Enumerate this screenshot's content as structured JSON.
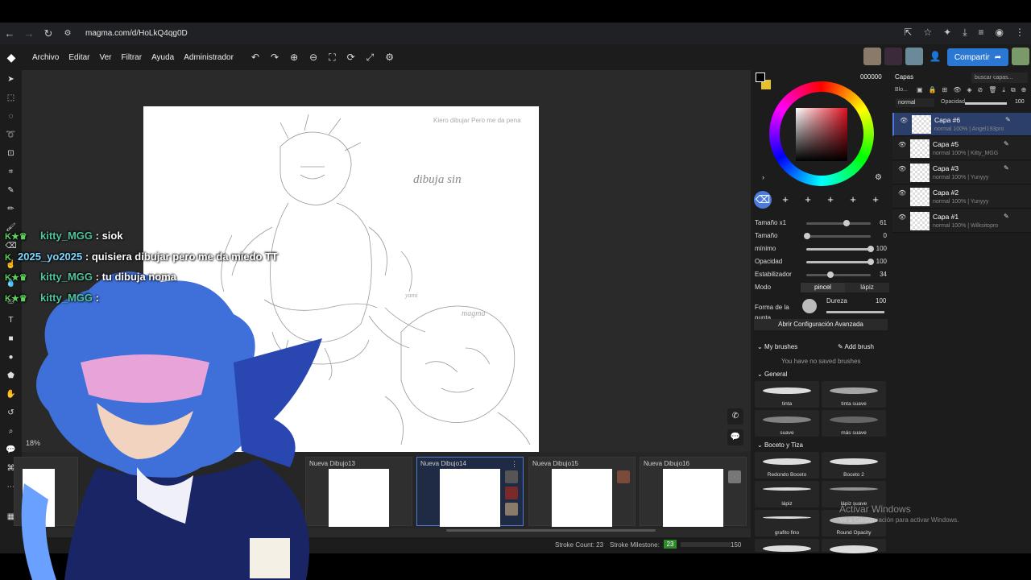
{
  "browser": {
    "url": "magma.com/d/HoLkQ4qg0D"
  },
  "menu": {
    "items": [
      "Archivo",
      "Editar",
      "Ver",
      "Filtrar",
      "Ayuda",
      "Administrador"
    ],
    "share_label": "Compartir"
  },
  "color_panel": {
    "hex": "000000",
    "primary_color": "#000000",
    "secondary_color": "#e6c12c"
  },
  "brush_slots": [
    "1",
    "2",
    "3",
    "4",
    "5",
    "6"
  ],
  "brush_props": {
    "size_x1_label": "Tamaño x1",
    "size_x1_value": "61",
    "size_label": "Tamaño",
    "size_value": "0",
    "min_label": "mínimo",
    "min_value": "100",
    "opacity_label": "Opacidad",
    "opacity_value": "100",
    "stabilizer_label": "Estabilizador",
    "stabilizer_value": "34",
    "mode_label": "Modo",
    "mode_pencil": "pincel",
    "mode_lapiz": "lápiz",
    "hardness_label": "Dureza",
    "hardness_value": "100",
    "tip_label": "Forma de la punta",
    "advanced_btn": "Abrir Configuración Avanzada"
  },
  "brush_library": {
    "my_brushes": "My brushes",
    "add_brush": "Add brush",
    "no_saved": "You have no saved brushes",
    "cat_general": "General",
    "cat_boceto": "Boceto y Tiza",
    "general": [
      "tinta",
      "tinta suave",
      "suave",
      "más suave"
    ],
    "boceto": [
      "Redondo Boceto",
      "Boceto 2",
      "lápiz",
      "lápiz suave",
      "grafito fino",
      "Round Opacity"
    ]
  },
  "layers": {
    "title": "Capas",
    "search_placeholder": "buscar capas...",
    "blo_label": "Blo...",
    "blend_mode": "normal",
    "opacity_label": "Opacidad",
    "opacity_value": "100",
    "items": [
      {
        "name": "Capa #6",
        "meta": "normal 100% | Angel193pro"
      },
      {
        "name": "Capa #5",
        "meta": "normal 100% | Kitty_MGG"
      },
      {
        "name": "Capa #3",
        "meta": "normal 100% | Yunyyy"
      },
      {
        "name": "Capa #2",
        "meta": "normal 100% | Yunyyy"
      },
      {
        "name": "Capa #1",
        "meta": "normal 100% | Wilksitopro"
      }
    ]
  },
  "drawings": [
    {
      "name": "Nueva Dibujo13"
    },
    {
      "name": "Nueva Dibujo14"
    },
    {
      "name": "Nueva Dibujo15"
    },
    {
      "name": "Nueva Dibujo16"
    }
  ],
  "canvas_text": {
    "t1": "Kiero dibujar Pero me da pena",
    "t2": "dibuja sin",
    "t3": "magma",
    "t4": "yami"
  },
  "status": {
    "zoom": "18%",
    "stroke_count": "Stroke Count: 23",
    "milestone_label": "Stroke Milestone:",
    "milestone_value": "23",
    "milestone_max": "150"
  },
  "chat": [
    {
      "user": "kitty_MGG",
      "text": ": siok"
    },
    {
      "user": "2025_yo2025",
      "text": ": quisiera dibujar pero me da miedo TT"
    },
    {
      "user": "kitty_MGG",
      "text": ": tu dibuja noma"
    },
    {
      "user": "kitty_MGG",
      "text": ":"
    }
  ],
  "watermark": {
    "title": "Activar Windows",
    "subtitle": "Ve a Configuración para activar Windows."
  }
}
